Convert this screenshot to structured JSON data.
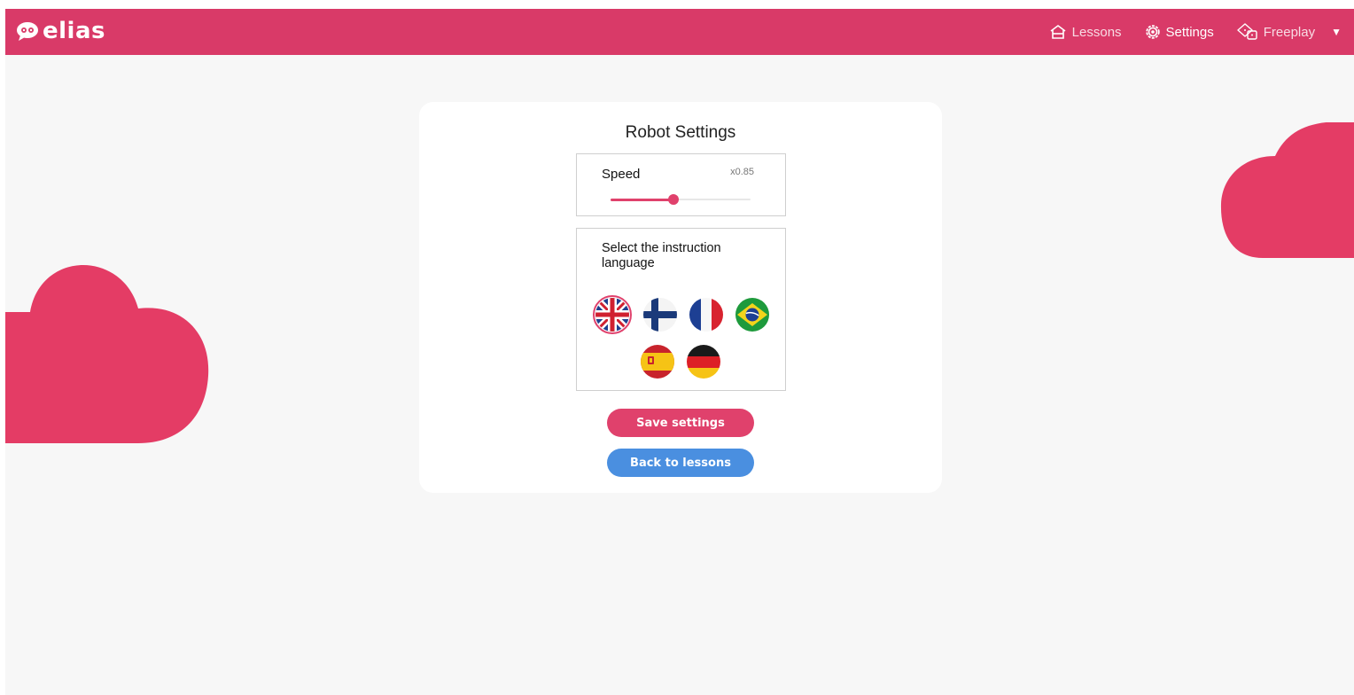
{
  "app": {
    "name": "elias"
  },
  "nav": {
    "lessons": "Lessons",
    "settings": "Settings",
    "freeplay": "Freeplay"
  },
  "settings": {
    "title": "Robot Settings",
    "speed_label": "Speed",
    "speed_value": "x0.85",
    "speed_level": 0.45,
    "language_label": "Select the instruction language",
    "languages": [
      {
        "icon": "uk-flag-icon",
        "selected": true
      },
      {
        "icon": "finland-flag-icon",
        "selected": false
      },
      {
        "icon": "france-flag-icon",
        "selected": false
      },
      {
        "icon": "brazil-flag-icon",
        "selected": false
      },
      {
        "icon": "spain-flag-icon",
        "selected": false
      },
      {
        "icon": "germany-flag-icon",
        "selected": false
      }
    ],
    "save_label": "Save settings",
    "back_label": "Back to lessons"
  },
  "colors": {
    "brand": "#d93a68",
    "accent": "#e0416c",
    "secondary": "#4a8fe0",
    "background": "#f7f7f7"
  }
}
